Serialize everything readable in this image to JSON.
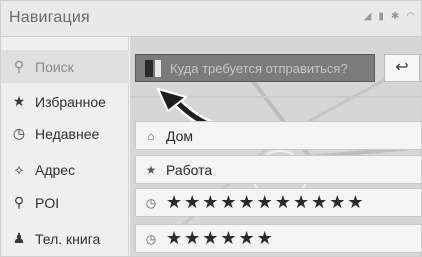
{
  "header": {
    "title": "Навигация",
    "status_icons": [
      "signal-icon",
      "battery-icon",
      "gear-icon",
      "wifi-icon"
    ]
  },
  "sidebar": {
    "items": [
      {
        "label": "Поиск",
        "icon": "search-icon"
      },
      {
        "label": "Избранное",
        "icon": "star-icon"
      },
      {
        "label": "Недавнее",
        "icon": "clock-icon"
      },
      {
        "label": "Адрес",
        "icon": "address-icon"
      },
      {
        "label": "POI",
        "icon": "pin-icon"
      },
      {
        "label": "Тел. книга",
        "icon": "person-icon"
      }
    ]
  },
  "search": {
    "placeholder": "Куда требуется отправиться?",
    "back_icon": "back-arrow-icon"
  },
  "list": {
    "items": [
      {
        "label": "Дом",
        "icon": "home-icon"
      },
      {
        "label": "Работа",
        "icon": "star-icon"
      },
      {
        "label": "★★★★★★★★★★★",
        "icon": "clock-icon"
      },
      {
        "label": "★★★★★★",
        "icon": "clock-icon"
      }
    ]
  }
}
